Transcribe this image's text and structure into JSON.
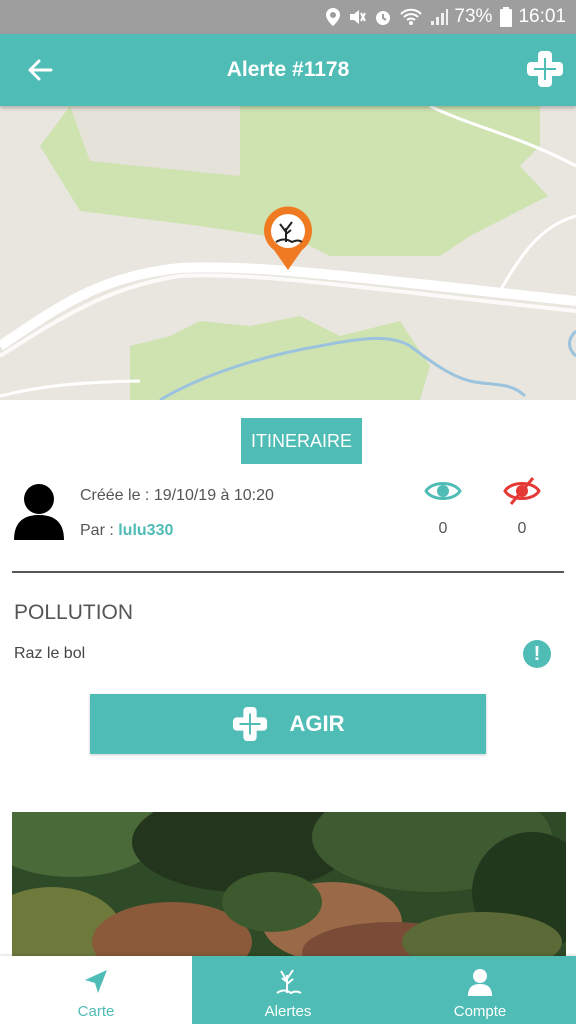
{
  "status_bar": {
    "battery": "73%",
    "time": "16:01"
  },
  "app_bar": {
    "title": "Alerte #1178"
  },
  "itinerary_button": "ITINERAIRE",
  "alert": {
    "created_label": "Créée le : 19/10/19 à 10:20",
    "by_label": "Par : ",
    "username": "lulu330",
    "views_count": "0",
    "hidden_count": "0",
    "category": "POLLUTION",
    "description": "Raz le bol"
  },
  "action_button": "AGIR",
  "bottom_nav": [
    {
      "label": "Carte",
      "icon": "navigation-arrow-icon"
    },
    {
      "label": "Alertes",
      "icon": "alert-tree-icon"
    },
    {
      "label": "Compte",
      "icon": "user-icon"
    }
  ],
  "colors": {
    "accent": "#4fbcb5",
    "marker": "#f07a22",
    "eye_off": "#e53935"
  }
}
